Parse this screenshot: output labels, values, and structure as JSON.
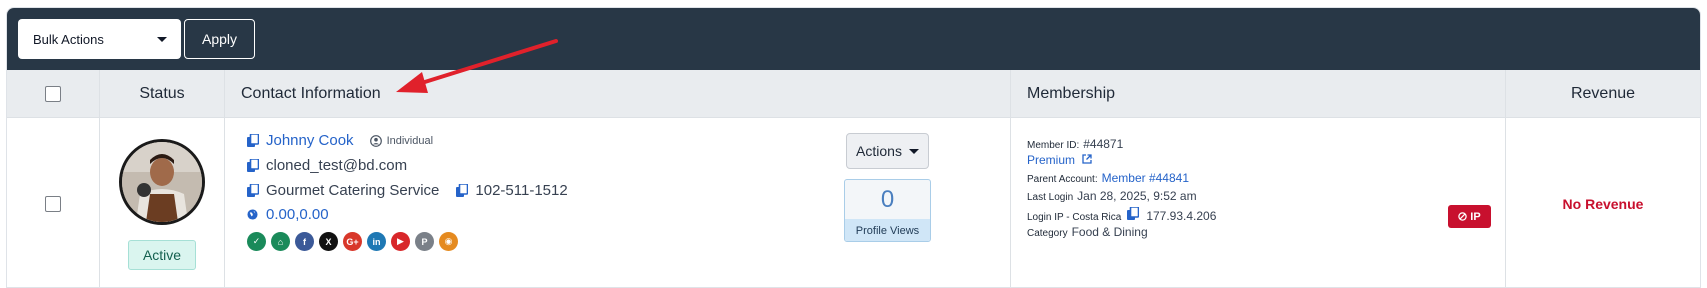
{
  "toolbar": {
    "bulk_actions_label": "Bulk Actions",
    "apply_label": "Apply"
  },
  "table": {
    "headers": {
      "status": "Status",
      "contact": "Contact Information",
      "membership": "Membership",
      "revenue": "Revenue"
    }
  },
  "row": {
    "status": "Active",
    "name": "Johnny Cook",
    "account_type": "Individual",
    "email": "cloned_test@bd.com",
    "company": "Gourmet Catering Service",
    "phone": "102-511-1512",
    "coordinates": "0.00,0.00",
    "actions_label": "Actions",
    "profile_views_count": "0",
    "profile_views_label": "Profile Views",
    "membership": {
      "member_id_label": "Member ID:",
      "member_id": "#44871",
      "plan": "Premium",
      "parent_account_label": "Parent Account:",
      "parent_account": "Member #44841",
      "last_login_label": "Last Login",
      "last_login": "Jan 28, 2025, 9:52 am",
      "login_ip_label": "Login IP - Costa Rica",
      "login_ip": "177.93.4.206",
      "category_label": "Category",
      "category": "Food & Dining",
      "ip_button": "IP"
    },
    "revenue": "No Revenue"
  },
  "socials": [
    {
      "icon": "verified-icon",
      "color": "#1a8a5a",
      "glyph": "✓"
    },
    {
      "icon": "home-icon",
      "color": "#1a8a5a",
      "glyph": "⌂"
    },
    {
      "icon": "facebook-icon",
      "color": "#3b5998",
      "glyph": "f"
    },
    {
      "icon": "x-icon",
      "color": "#111111",
      "glyph": "X"
    },
    {
      "icon": "google-plus-icon",
      "color": "#d8372a",
      "glyph": "G+"
    },
    {
      "icon": "linkedin-icon",
      "color": "#1e78b4",
      "glyph": "in"
    },
    {
      "icon": "youtube-icon",
      "color": "#d8272a",
      "glyph": "▶"
    },
    {
      "icon": "pinterest-icon",
      "color": "#7a8088",
      "glyph": "P"
    },
    {
      "icon": "rss-icon",
      "color": "#e58a1f",
      "glyph": "◉"
    }
  ],
  "colors": {
    "toolbar_bg": "#283746",
    "link": "#2563c9",
    "danger": "#c8102e",
    "active_badge_bg": "#daf5ef"
  }
}
